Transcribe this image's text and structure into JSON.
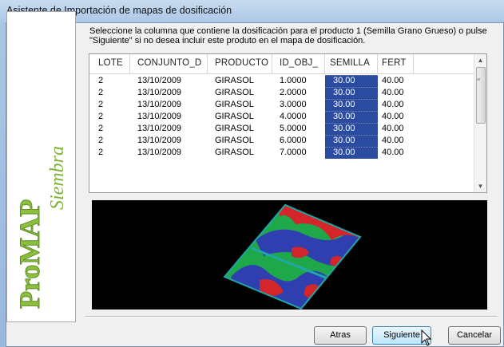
{
  "window": {
    "title": "Asistente de Importación de mapas de dosificación"
  },
  "instructions": {
    "line1": "Seleccione la columna que contiene la dosificación para el producto 1 (Semilla Grano Grueso) o pulse",
    "line2": "\"Siguiente\" si no desea incluir este produto en el mapa de dosificación."
  },
  "table": {
    "columns": [
      "LOTE",
      "CONJUNTO_D",
      "PRODUCTO",
      "ID_OBJ_",
      "SEMILLA",
      "FERT"
    ],
    "selected_column": "SEMILLA",
    "rows": [
      [
        "2",
        "13/10/2009",
        "GIRASOL",
        "1.0000",
        "30.00",
        "40.00"
      ],
      [
        "2",
        "13/10/2009",
        "GIRASOL",
        "2.0000",
        "30.00",
        "40.00"
      ],
      [
        "2",
        "13/10/2009",
        "GIRASOL",
        "3.0000",
        "30.00",
        "40.00"
      ],
      [
        "2",
        "13/10/2009",
        "GIRASOL",
        "4.0000",
        "30.00",
        "40.00"
      ],
      [
        "2",
        "13/10/2009",
        "GIRASOL",
        "5.0000",
        "30.00",
        "40.00"
      ],
      [
        "2",
        "13/10/2009",
        "GIRASOL",
        "6.0000",
        "30.00",
        "40.00"
      ],
      [
        "2",
        "13/10/2009",
        "GIRASOL",
        "7.0000",
        "30.00",
        "40.00"
      ]
    ]
  },
  "side_banner": {
    "logo_text": "ProMAP",
    "sub_text": "Siembra"
  },
  "map_preview": {
    "colors": [
      "#d4262a",
      "#2f3fb0",
      "#1fa84a",
      "#1fa6a6"
    ]
  },
  "buttons": {
    "back": "Atras",
    "next": "Siguiente",
    "cancel": "Cancelar"
  }
}
